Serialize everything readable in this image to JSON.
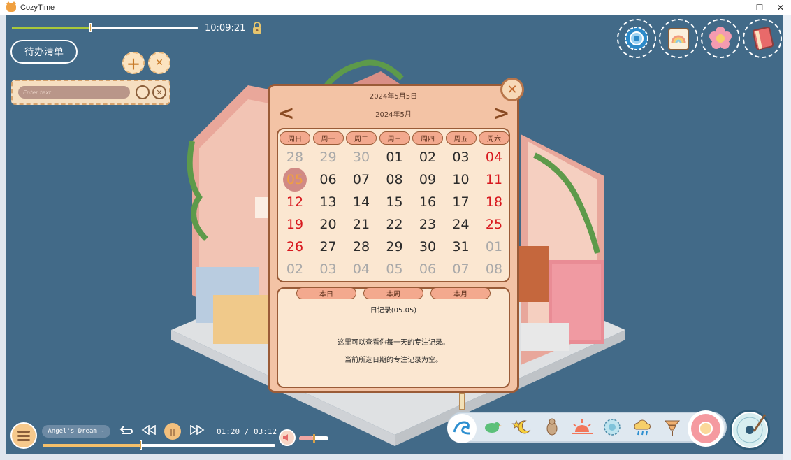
{
  "window": {
    "title": "CozyTime",
    "minimize": "—",
    "maximize": "☐",
    "close": "✕"
  },
  "top": {
    "time": "10:09:21",
    "progress": 0.42
  },
  "todo": {
    "button_label": "待办清单",
    "add_icon": "plus-icon",
    "close_icon": "close-icon",
    "input_placeholder": "Enter text..."
  },
  "top_right_icons": [
    "settings-gear-icon",
    "calendar-rainbow-icon",
    "flower-icon",
    "notebook-icon"
  ],
  "calendar": {
    "selected_date_label": "2024年5月5日",
    "month_label": "2024年5月",
    "prev": "<",
    "next": ">",
    "close": "✕",
    "weekdays": [
      "周日",
      "周一",
      "周二",
      "周三",
      "周四",
      "周五",
      "周六"
    ],
    "weeks": [
      [
        "28",
        "29",
        "30",
        "01",
        "02",
        "03",
        "04"
      ],
      [
        "05",
        "06",
        "07",
        "08",
        "09",
        "10",
        "11"
      ],
      [
        "12",
        "13",
        "14",
        "15",
        "16",
        "17",
        "18"
      ],
      [
        "19",
        "20",
        "21",
        "22",
        "23",
        "24",
        "25"
      ],
      [
        "26",
        "27",
        "28",
        "29",
        "30",
        "31",
        "01"
      ],
      [
        "02",
        "03",
        "04",
        "05",
        "06",
        "07",
        "08"
      ]
    ],
    "other_month": [
      [
        true,
        true,
        true,
        false,
        false,
        false,
        false
      ],
      [
        false,
        false,
        false,
        false,
        false,
        false,
        false
      ],
      [
        false,
        false,
        false,
        false,
        false,
        false,
        false
      ],
      [
        false,
        false,
        false,
        false,
        false,
        false,
        false
      ],
      [
        false,
        false,
        false,
        false,
        false,
        false,
        true
      ],
      [
        true,
        true,
        true,
        true,
        true,
        true,
        true
      ]
    ],
    "selected": {
      "week": 1,
      "day": 0
    },
    "record_tabs": [
      "本日",
      "本周",
      "本月"
    ],
    "record_title": "日记录(05.05)",
    "record_lines": [
      "这里可以查看你每一天的专注记录。",
      "当前所选日期的专注记录为空。"
    ]
  },
  "player": {
    "track": "Angel's Dream -",
    "time": "01:20 / 03:12",
    "progress": 0.42,
    "volume": 0.5,
    "repeat_icon": "repeat-icon",
    "prev_icon": "rewind-icon",
    "pause_icon": "pause-icon",
    "next_icon": "fast-forward-icon",
    "volume_icon": "speaker-icon"
  },
  "ambient": [
    "wave-icon",
    "bird-icon",
    "star-moon-icon",
    "cricket-icon",
    "sunset-icon",
    "snowflake-icon",
    "rain-cloud-icon",
    "wind-icon"
  ],
  "colors": {
    "background": "#426a88",
    "calendar_bg": "#f3c3a5",
    "calendar_border": "#9a5b37",
    "weekend": "#d8181e",
    "other_month": "#a9a9a9",
    "selected": "#f0a040"
  }
}
